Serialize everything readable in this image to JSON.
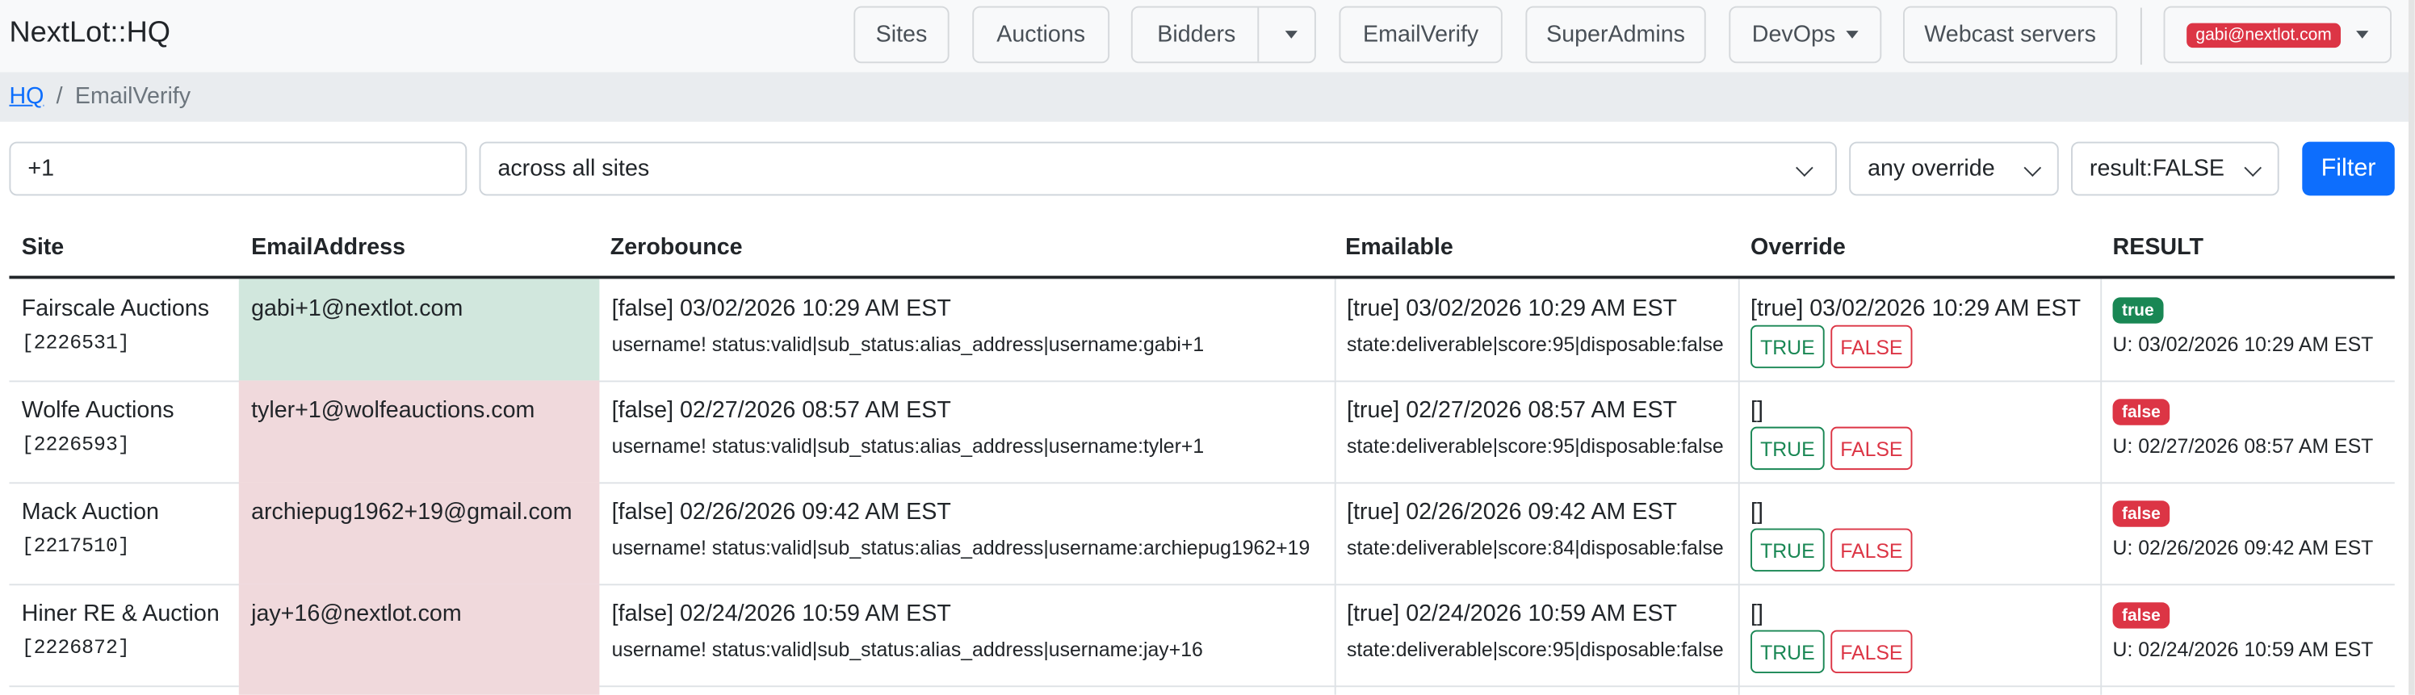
{
  "navbar": {
    "brand": "NextLot::HQ",
    "items": [
      "Sites",
      "Auctions",
      "Bidders",
      "EmailVerify",
      "SuperAdmins",
      "DevOps",
      "Webcast servers"
    ],
    "user_email": "gabi@nextlot.com"
  },
  "breadcrumb": {
    "home": "HQ",
    "separator": "/",
    "current": "EmailVerify"
  },
  "filters": {
    "query": "+1",
    "site_scope": "across all sites",
    "override": "any override",
    "result": "result:FALSE",
    "filter_label": "Filter"
  },
  "table": {
    "headers": [
      "Site",
      "EmailAddress",
      "Zerobounce",
      "Emailable",
      "Override",
      "RESULT"
    ],
    "rows": [
      {
        "site": "Fairscale Auctions",
        "site_id": "[2226531]",
        "email": "gabi+1@nextlot.com",
        "zerobounce": "[false] 03/02/2026 10:29 AM EST",
        "zerobounce_detail": "username! status:valid|sub_status:alias_address|username:gabi+1",
        "emailable": "[true] 03/02/2026 10:29 AM EST",
        "emailable_detail": "state:deliverable|score:95|disposable:false",
        "override": "[true] 03/02/2026 10:29 AM EST",
        "btn_true": "TRUE",
        "btn_false": "FALSE",
        "result": "true",
        "result_line": "U: 03/02/2026 10:29 AM EST"
      },
      {
        "site": "Wolfe Auctions",
        "site_id": "[2226593]",
        "email": "tyler+1@wolfeauctions.com",
        "zerobounce": "[false] 02/27/2026 08:57 AM EST",
        "zerobounce_detail": "username! status:valid|sub_status:alias_address|username:tyler+1",
        "emailable": "[true] 02/27/2026 08:57 AM EST",
        "emailable_detail": "state:deliverable|score:95|disposable:false",
        "override": "[]",
        "btn_true": "TRUE",
        "btn_false": "FALSE",
        "result": "false",
        "result_line": "U: 02/27/2026 08:57 AM EST"
      },
      {
        "site": "Mack Auction",
        "site_id": "[2217510]",
        "email": "archiepug1962+19@gmail.com",
        "zerobounce": "[false] 02/26/2026 09:42 AM EST",
        "zerobounce_detail": "username! status:valid|sub_status:alias_address|username:archiepug1962+19",
        "emailable": "[true] 02/26/2026 09:42 AM EST",
        "emailable_detail": "state:deliverable|score:84|disposable:false",
        "override": "[]",
        "btn_true": "TRUE",
        "btn_false": "FALSE",
        "result": "false",
        "result_line": "U: 02/26/2026 09:42 AM EST"
      },
      {
        "site": "Hiner RE & Auction",
        "site_id": "[2226872]",
        "email": "jay+16@nextlot.com",
        "zerobounce": "[false] 02/24/2026 10:59 AM EST",
        "zerobounce_detail": "username! status:valid|sub_status:alias_address|username:jay+16",
        "emailable": "[true] 02/24/2026 10:59 AM EST",
        "emailable_detail": "state:deliverable|score:95|disposable:false",
        "override": "[]",
        "btn_true": "TRUE",
        "btn_false": "FALSE",
        "result": "false",
        "result_line": "U: 02/24/2026 10:59 AM EST"
      }
    ]
  },
  "colors": {
    "primary": "#0d6efd",
    "danger": "#dc3545",
    "success": "#198754",
    "email_ok_bg": "#d1e7dd",
    "email_bad_bg": "#f0d9dc"
  }
}
